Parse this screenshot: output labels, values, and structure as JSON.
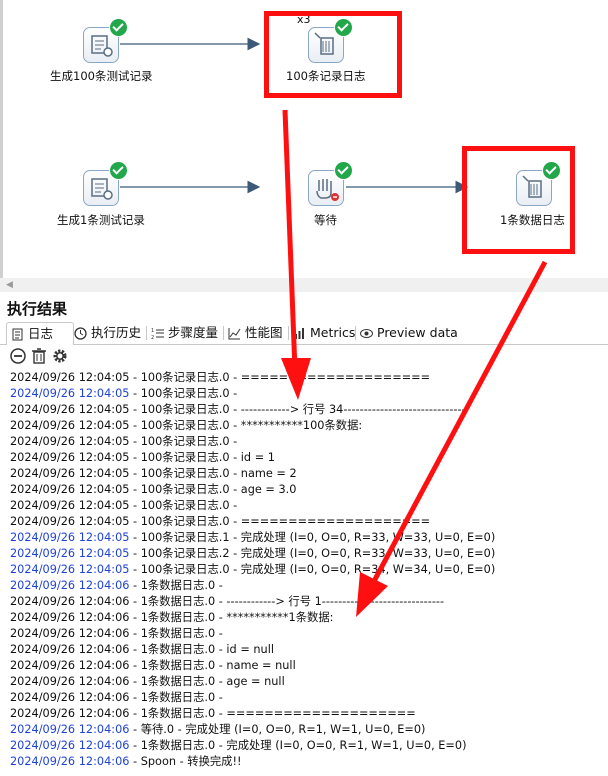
{
  "canvas": {
    "steps": [
      {
        "label": "生成100条测试记录",
        "icon": "generate-rows-icon"
      },
      {
        "label": "100条记录日志",
        "icon": "write-to-log-icon",
        "badge": "x3"
      },
      {
        "label": "生成1条测试记录",
        "icon": "generate-rows-icon"
      },
      {
        "label": "等待",
        "icon": "wait-icon"
      },
      {
        "label": "1条数据日志",
        "icon": "write-to-log-icon"
      }
    ]
  },
  "panel": {
    "title": "执行结果",
    "tabs": [
      "日志",
      "执行历史",
      "步骤度量",
      "性能图",
      "Metrics",
      "Preview data"
    ],
    "toolbar": [
      "stop-icon",
      "trash-icon",
      "gear-icon"
    ]
  },
  "log": [
    {
      "ts": "2024/09/26 12:04:05",
      "msg": " - 100条记录日志.0 - ====================",
      "blue": false
    },
    {
      "ts": "2024/09/26 12:04:05",
      "msg": " - 100条记录日志.0 - ",
      "blue": true
    },
    {
      "ts": "2024/09/26 12:04:05",
      "msg": " - 100条记录日志.0 - ------------> 行号 34------------------------------",
      "blue": false
    },
    {
      "ts": "2024/09/26 12:04:05",
      "msg": " - 100条记录日志.0 - ***********100条数据:",
      "blue": false
    },
    {
      "ts": "2024/09/26 12:04:05",
      "msg": " - 100条记录日志.0 - ",
      "blue": false
    },
    {
      "ts": "2024/09/26 12:04:05",
      "msg": " - 100条记录日志.0 - id = 1",
      "blue": false
    },
    {
      "ts": "2024/09/26 12:04:05",
      "msg": " - 100条记录日志.0 - name = 2",
      "blue": false
    },
    {
      "ts": "2024/09/26 12:04:05",
      "msg": " - 100条记录日志.0 - age = 3.0",
      "blue": false
    },
    {
      "ts": "2024/09/26 12:04:05",
      "msg": " - 100条记录日志.0 - ",
      "blue": false
    },
    {
      "ts": "2024/09/26 12:04:05",
      "msg": " - 100条记录日志.0 - ====================",
      "blue": false
    },
    {
      "ts": "2024/09/26 12:04:05",
      "msg": " - 100条记录日志.1 - 完成处理 (I=0, O=0, R=33, W=33, U=0, E=0)",
      "blue": true
    },
    {
      "ts": "2024/09/26 12:04:05",
      "msg": " - 100条记录日志.2 - 完成处理 (I=0, O=0, R=33, W=33, U=0, E=0)",
      "blue": true
    },
    {
      "ts": "2024/09/26 12:04:05",
      "msg": " - 100条记录日志.0 - 完成处理 (I=0, O=0, R=34, W=34, U=0, E=0)",
      "blue": true
    },
    {
      "ts": "2024/09/26 12:04:06",
      "msg": " - 1条数据日志.0 - ",
      "blue": true
    },
    {
      "ts": "2024/09/26 12:04:06",
      "msg": " - 1条数据日志.0 - ------------> 行号 1------------------------------",
      "blue": false
    },
    {
      "ts": "2024/09/26 12:04:06",
      "msg": " - 1条数据日志.0 - ***********1条数据:",
      "blue": false
    },
    {
      "ts": "2024/09/26 12:04:06",
      "msg": " - 1条数据日志.0 - ",
      "blue": false
    },
    {
      "ts": "2024/09/26 12:04:06",
      "msg": " - 1条数据日志.0 - id = null",
      "blue": false
    },
    {
      "ts": "2024/09/26 12:04:06",
      "msg": " - 1条数据日志.0 - name = null",
      "blue": false
    },
    {
      "ts": "2024/09/26 12:04:06",
      "msg": " - 1条数据日志.0 - age = null",
      "blue": false
    },
    {
      "ts": "2024/09/26 12:04:06",
      "msg": " - 1条数据日志.0 - ",
      "blue": false
    },
    {
      "ts": "2024/09/26 12:04:06",
      "msg": " - 1条数据日志.0 - ====================",
      "blue": false
    },
    {
      "ts": "2024/09/26 12:04:06",
      "msg": " - 等待.0 - 完成处理 (I=0, O=0, R=1, W=1, U=0, E=0)",
      "blue": true
    },
    {
      "ts": "2024/09/26 12:04:06",
      "msg": " - 1条数据日志.0 - 完成处理 (I=0, O=0, R=1, W=1, U=0, E=0)",
      "blue": true
    },
    {
      "ts": "2024/09/26 12:04:06",
      "msg": " - Spoon - 转换完成!!",
      "blue": true
    }
  ],
  "colors": {
    "highlight": "#ff1010",
    "timestamp_blue": "#1f43d8",
    "ok_green": "#22a84a"
  }
}
